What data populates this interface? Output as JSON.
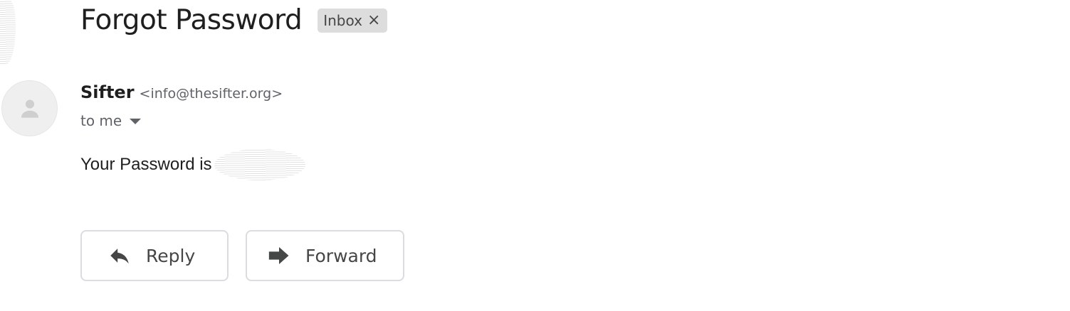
{
  "email": {
    "subject": "Forgot Password",
    "label": "Inbox",
    "label_remove_glyph": "×",
    "sender": {
      "name": "Sifter",
      "address": "<info@thesifter.org>"
    },
    "recipient": "to me",
    "body_text": "Your Password is"
  },
  "actions": {
    "reply_label": "Reply",
    "forward_label": "Forward"
  },
  "icons": {
    "avatar": "person-icon",
    "reply": "reply-arrow-icon",
    "forward": "forward-arrow-icon",
    "recipient_toggle": "caret-down-icon",
    "label_remove": "close-icon"
  },
  "colors": {
    "chip_background": "#dddddd",
    "button_border": "#dadce0",
    "secondary_text": "#5f6368",
    "primary_text": "#1f1f1f"
  }
}
